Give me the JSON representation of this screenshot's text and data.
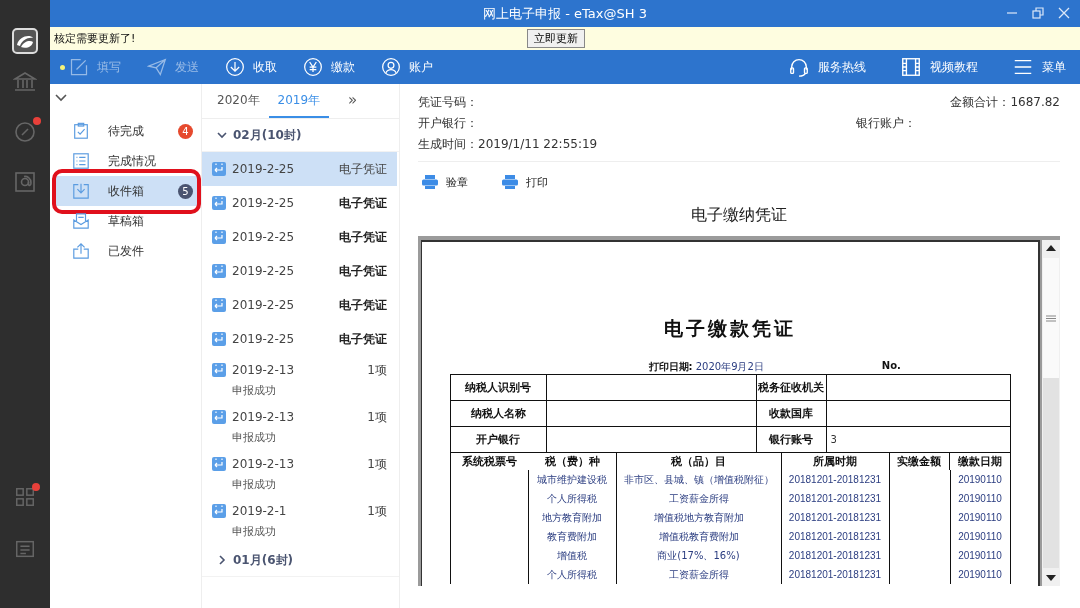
{
  "window": {
    "title": "网上电子申报 - eTax@SH 3"
  },
  "notice": {
    "text": "核定需要更新了!",
    "button": "立即更新"
  },
  "rail": {
    "top": [
      {
        "kind": "bank",
        "alert": false
      },
      {
        "kind": "compass",
        "alert": true
      },
      {
        "kind": "mail",
        "alert": false
      }
    ],
    "bottom": [
      {
        "kind": "grid",
        "alert": true
      },
      {
        "kind": "list",
        "alert": false
      }
    ]
  },
  "toolbar": {
    "left": [
      {
        "label": "填写",
        "kind": "edit",
        "disabled": true
      },
      {
        "label": "发送",
        "kind": "send",
        "disabled": true
      },
      {
        "label": "收取",
        "kind": "download",
        "disabled": false
      },
      {
        "label": "缴款",
        "kind": "yen",
        "disabled": false
      },
      {
        "label": "账户",
        "kind": "user",
        "disabled": false
      }
    ],
    "right": [
      {
        "label": "服务热线",
        "kind": "headset"
      },
      {
        "label": "视频教程",
        "kind": "film"
      },
      {
        "label": "菜单",
        "kind": "menu"
      }
    ]
  },
  "nav": {
    "items": [
      {
        "label": "待完成",
        "kind": "clipboard",
        "badge": "4",
        "color": "#e64a2e",
        "selected": false,
        "annotated": false
      },
      {
        "label": "完成情况",
        "kind": "list",
        "selected": false,
        "annotated": false
      },
      {
        "label": "收件箱",
        "kind": "inbox",
        "badge": "5",
        "color": "#4a5470",
        "selected": true,
        "annotated": true
      },
      {
        "label": "草稿箱",
        "kind": "draft",
        "selected": false,
        "annotated": false
      },
      {
        "label": "已发件",
        "kind": "upload",
        "selected": false,
        "annotated": false
      }
    ]
  },
  "messages": {
    "tabs": [
      {
        "label": "2020年",
        "selected": false
      },
      {
        "label": "2019年",
        "selected": true
      }
    ],
    "next": "»",
    "groups": [
      {
        "label": "02月(10封)",
        "expanded": true,
        "items": [
          {
            "date": "2019-2-25",
            "tag": "电子凭证",
            "unread": false,
            "selected": true
          },
          {
            "date": "2019-2-25",
            "tag": "电子凭证",
            "unread": true,
            "selected": false
          },
          {
            "date": "2019-2-25",
            "tag": "电子凭证",
            "unread": true,
            "selected": false
          },
          {
            "date": "2019-2-25",
            "tag": "电子凭证",
            "unread": true,
            "selected": false
          },
          {
            "date": "2019-2-25",
            "tag": "电子凭证",
            "unread": true,
            "selected": false
          },
          {
            "date": "2019-2-25",
            "tag": "电子凭证",
            "unread": true,
            "selected": false
          },
          {
            "date": "2019-2-13",
            "tag": "1项",
            "status": "申报成功",
            "unread": false,
            "selected": false
          },
          {
            "date": "2019-2-13",
            "tag": "1项",
            "status": "申报成功",
            "unread": false,
            "selected": false
          },
          {
            "date": "2019-2-13",
            "tag": "1项",
            "status": "申报成功",
            "unread": false,
            "selected": false
          },
          {
            "date": "2019-2-1",
            "tag": "1项",
            "status": "申报成功",
            "unread": false,
            "selected": false
          }
        ]
      },
      {
        "label": "01月(6封)",
        "expanded": false
      }
    ]
  },
  "detail": {
    "voucher_no": {
      "label": "凭证号码："
    },
    "total": {
      "label": "金额合计：",
      "value": "1687.82"
    },
    "bank": {
      "label": "开户银行："
    },
    "account": {
      "label": "银行账户："
    },
    "created": {
      "label": "生成时间：",
      "value": "2019/1/11 22:55:19"
    },
    "actions": [
      "验章",
      "打印"
    ],
    "title": "电子缴纳凭证",
    "document": {
      "title": "电子缴款凭证",
      "print_date_label": "打印日期:",
      "print_date": "2020年9月2日",
      "no_label": "No.",
      "info_rows": [
        {
          "label": "纳税人识别号",
          "label2": "税务征收机关"
        },
        {
          "label": "纳税人名称",
          "label2": "收款国库"
        },
        {
          "label": "开户银行",
          "label2": "银行账号",
          "value2": "3"
        }
      ],
      "columns": [
        "系统税票号",
        "税（费）种",
        "税（品）目",
        "所属时期",
        "实缴金额",
        "缴款日期"
      ],
      "rows": [
        {
          "tax": "城市维护建设税",
          "item": "非市区、县城、镇（增值税附征）",
          "period": "20181201-20181231",
          "date": "20190110"
        },
        {
          "tax": "个人所得税",
          "item": "工资薪金所得",
          "period": "20181201-20181231",
          "date": "20190110"
        },
        {
          "tax": "地方教育附加",
          "item": "增值税地方教育附加",
          "period": "20181201-20181231",
          "date": "20190110"
        },
        {
          "tax": "教育费附加",
          "item": "增值税教育费附加",
          "period": "20181201-20181231",
          "date": "20190110"
        },
        {
          "tax": "增值税",
          "item": "商业(17%、16%)",
          "period": "20181201-20181231",
          "date": "20190110"
        },
        {
          "tax": "个人所得税",
          "item": "工资薪金所得",
          "period": "20181201-20181231",
          "date": "20190110"
        }
      ]
    }
  }
}
